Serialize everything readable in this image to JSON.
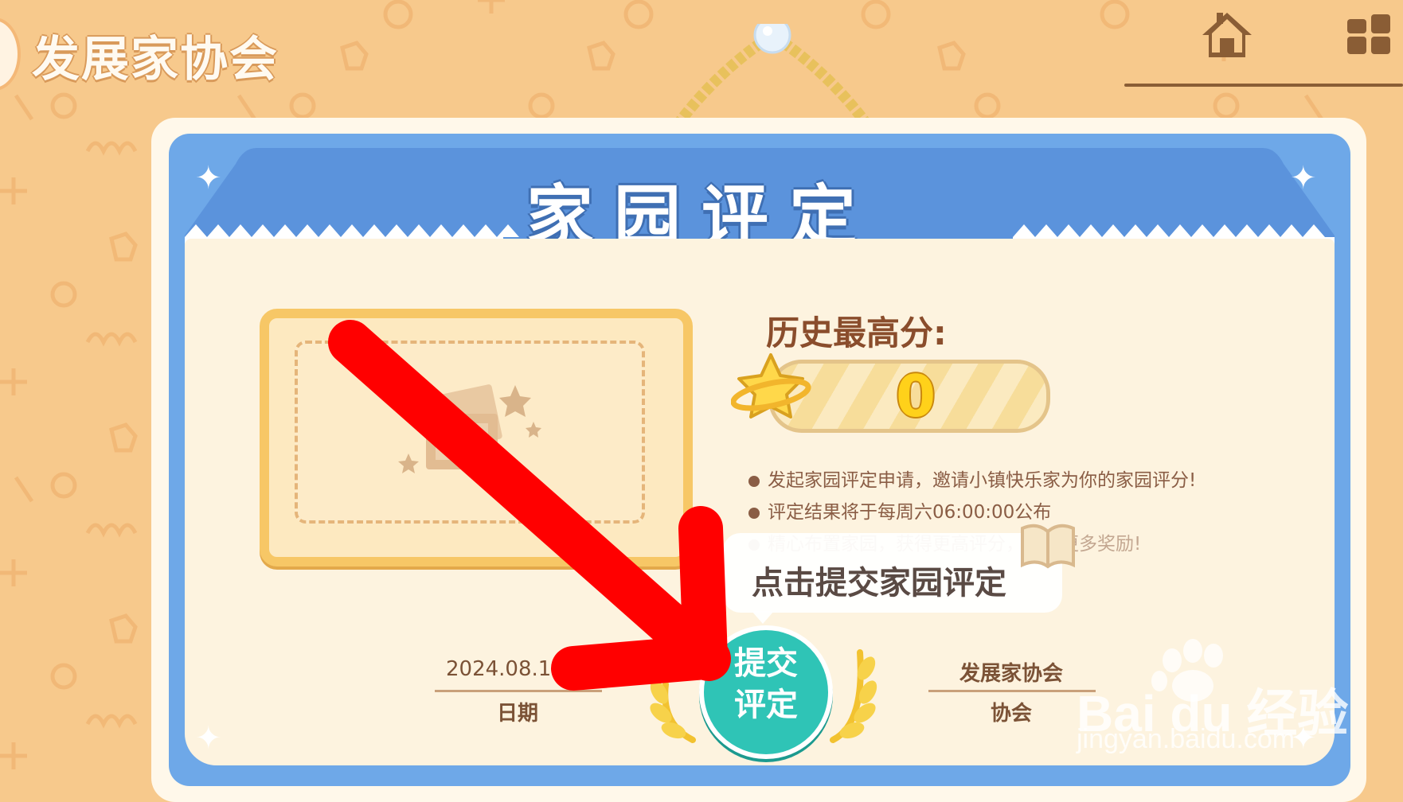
{
  "header": {
    "title": "发展家协会",
    "home_icon": "home-icon",
    "grid_icon": "grid-icon"
  },
  "board": {
    "title": "家园评定",
    "score": {
      "label": "历史最高分:",
      "value": "0"
    },
    "rules": [
      "发起家园评定申请，邀请小镇快乐家为你的家园评分!",
      "评定结果将于每周六06:00:00公布",
      "精心布置家园，获得更高评分，获得更多奖励!"
    ],
    "tooltip": "点击提交家园评定",
    "date": {
      "value": "2024.08.1",
      "label": "日期"
    },
    "association": {
      "value": "发展家协会",
      "label": "协会"
    },
    "submit_button": {
      "line1": "提交",
      "line2": "评定"
    }
  },
  "watermark": {
    "brand": "Bai du 经验",
    "url": "jingyan.baidu.com"
  },
  "colors": {
    "background": "#f7c98c",
    "board_blue": "#6ea8e8",
    "submit_teal": "#2fc4b6",
    "annotation_red": "#ff0000"
  }
}
